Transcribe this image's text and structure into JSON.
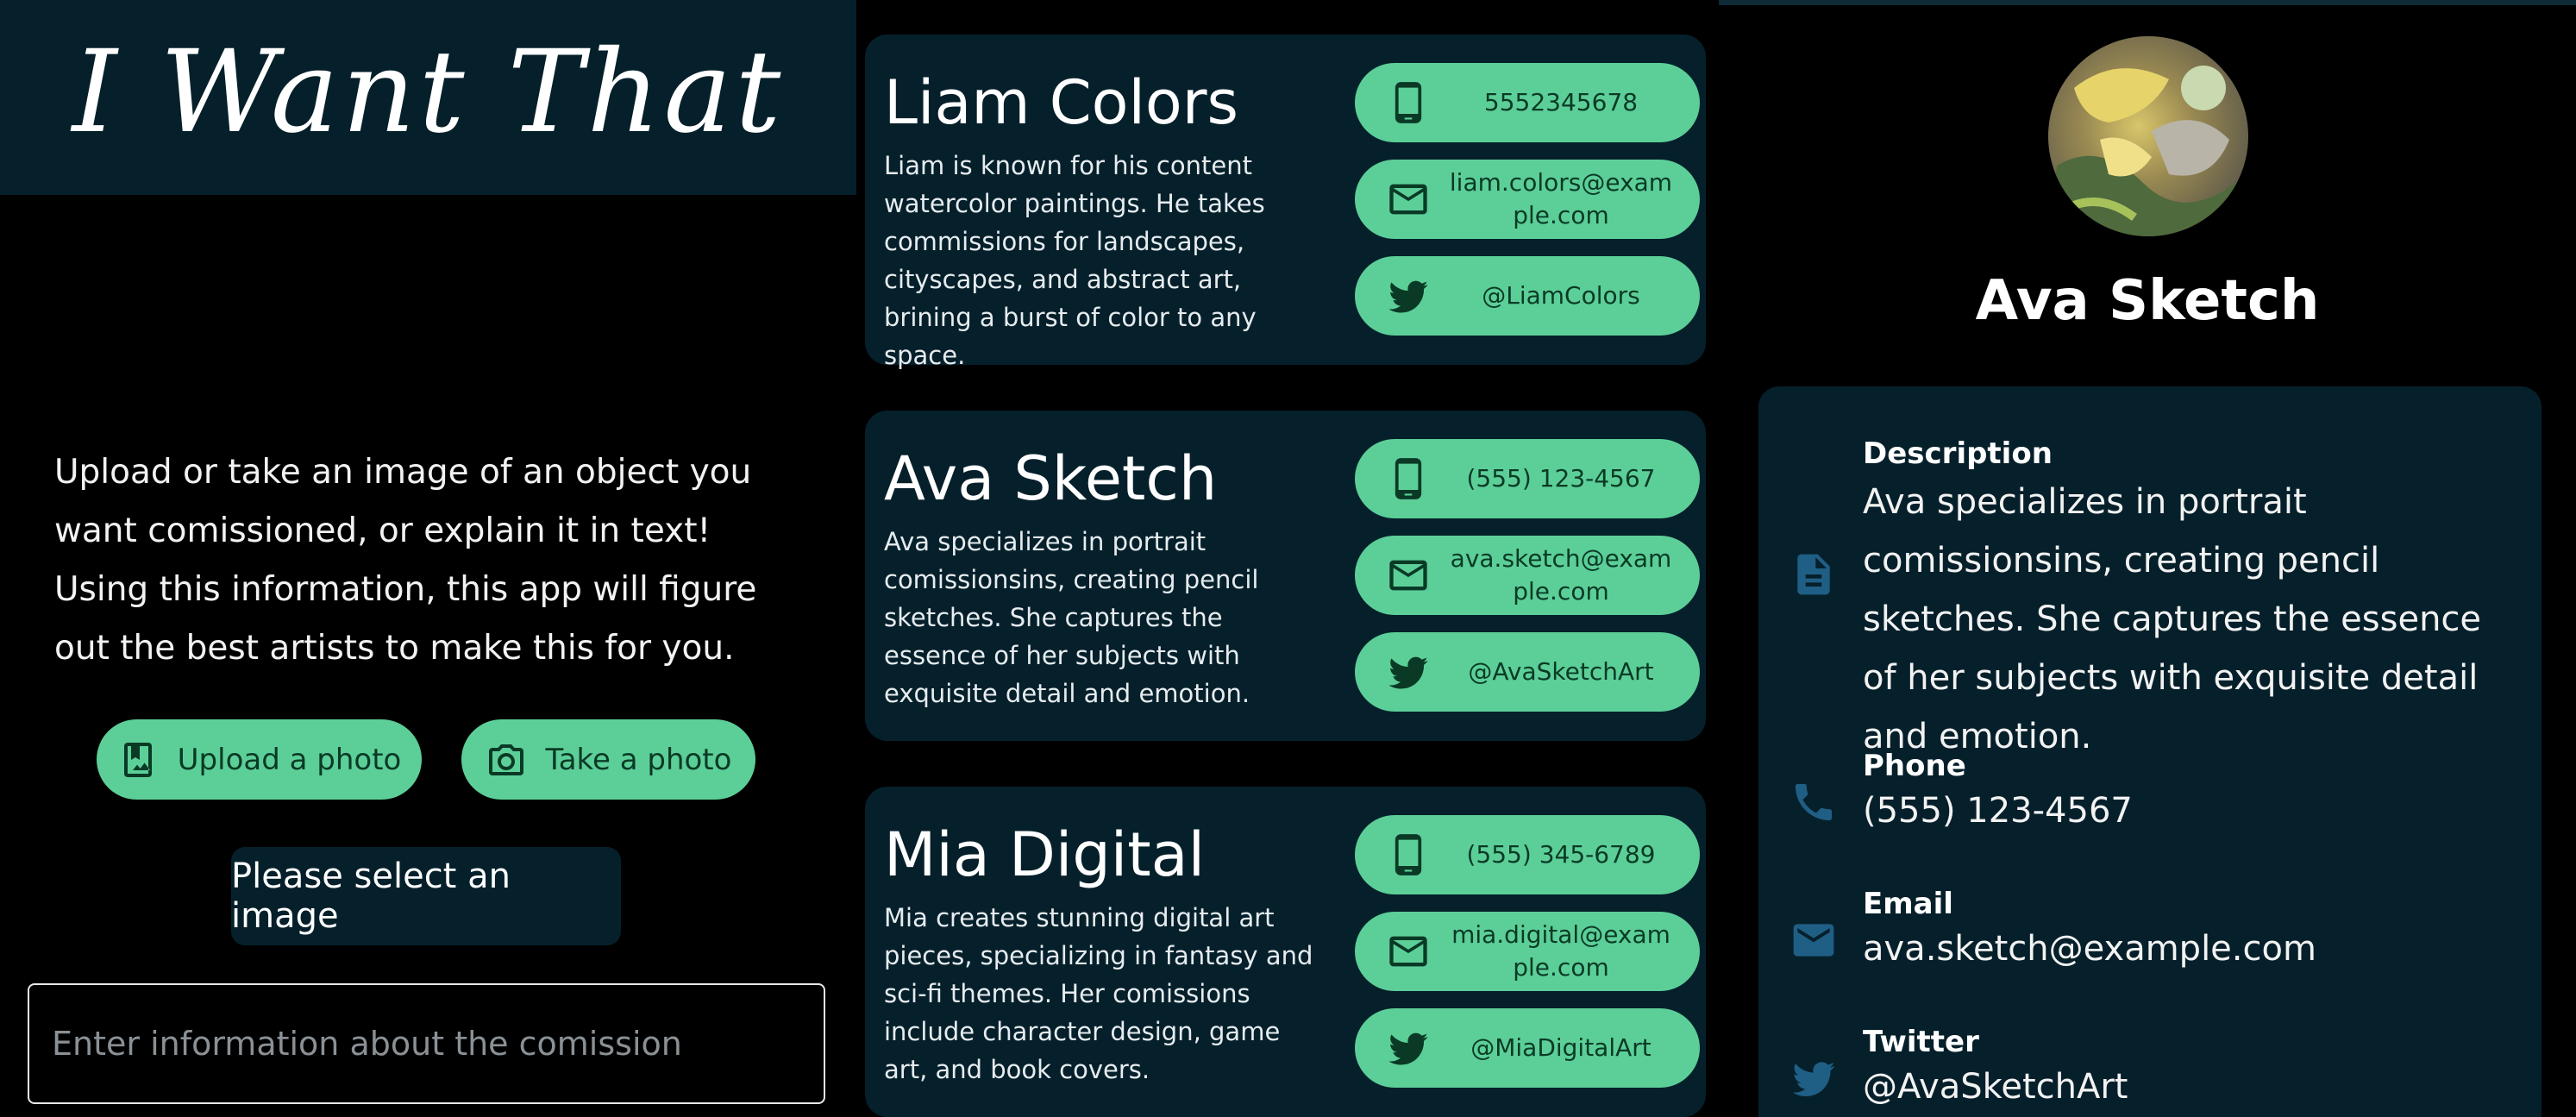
{
  "app": {
    "title": "I Want That",
    "intro": "Upload or take an image of an object you want comissioned, or explain it in text! Using this information, this app will figure out the best artists to make this for you.",
    "upload_label": "Upload a photo",
    "take_label": "Take a photo",
    "select_prompt": "Please select an image",
    "input_placeholder": "Enter information about the comission"
  },
  "artists": [
    {
      "name": "Liam Colors",
      "description": "Liam is known for his content watercolor paintings. He takes commissions for landscapes, cityscapes, and abstract art, brining a burst of color to any space.",
      "phone": "5552345678",
      "email": "liam.colors@example.com",
      "twitter": "@LiamColors"
    },
    {
      "name": "Ava Sketch",
      "description": "Ava specializes in portrait comissionsins, creating pencil sketches. She captures the essence of her subjects with exquisite detail and emotion.",
      "phone": "(555) 123-4567",
      "email": "ava.sketch@example.com",
      "twitter": "@AvaSketchArt"
    },
    {
      "name": "Mia Digital",
      "description": "Mia creates stunning digital art pieces, specializing in fantasy and sci-fi themes. Her comissions include character design, game art, and book covers.",
      "phone": "(555) 345-6789",
      "email": "mia.digital@example.com",
      "twitter": "@MiaDigitalArt"
    }
  ],
  "profile": {
    "name": "Ava Sketch",
    "description_label": "Description",
    "description": "Ava specializes in portrait comissionsins, creating pencil sketches. She captures the essence of her subjects with exquisite detail and emotion.",
    "phone_label": "Phone",
    "phone": "(555) 123-4567",
    "email_label": "Email",
    "email": "ava.sketch@example.com",
    "twitter_label": "Twitter",
    "twitter": "@AvaSketchArt"
  },
  "icons": {
    "upload": "image-upload-icon",
    "camera": "camera-icon",
    "phone": "smartphone-icon",
    "mail": "mail-icon",
    "twitter": "twitter-bird-icon",
    "description": "document-icon",
    "handset": "phone-handset-icon"
  },
  "colors": {
    "accent": "#5ccf98",
    "accent_text": "#0a3a26",
    "card_bg": "#06202b",
    "detail_icon": "#1f5f86"
  }
}
